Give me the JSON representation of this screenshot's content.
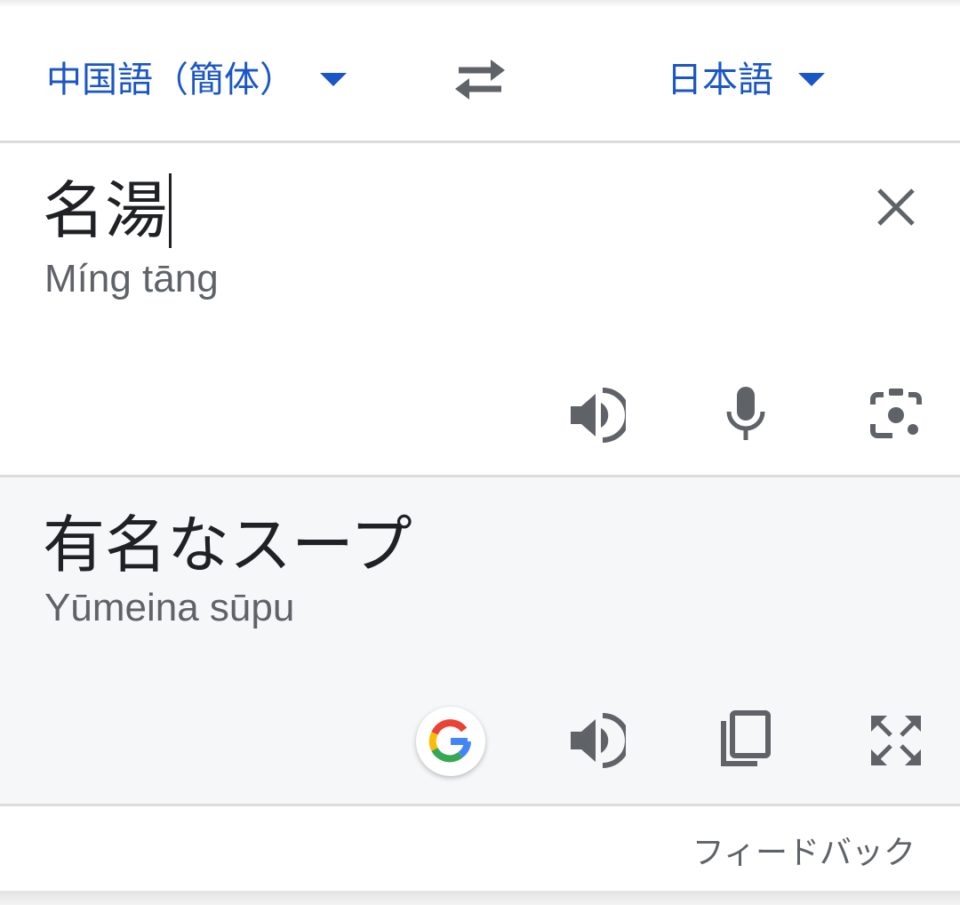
{
  "languages": {
    "source": "中国語（簡体）",
    "target": "日本語"
  },
  "input": {
    "text": "名湯",
    "romanization": "Míng tāng"
  },
  "output": {
    "text": "有名なスープ",
    "romanization": "Yūmeina sūpu"
  },
  "feedback_label": "フィードバック",
  "icons": {
    "swap": "swap-arrows-icon",
    "clear": "close-icon",
    "listen": "speaker-icon",
    "mic": "microphone-icon",
    "camera": "camera-lens-icon",
    "google": "google-g-icon",
    "copy": "copy-icon",
    "fullscreen": "fullscreen-icon"
  },
  "colors": {
    "accent": "#1a56c6",
    "icon": "#5f6368",
    "output_bg": "#f6f7f9"
  }
}
